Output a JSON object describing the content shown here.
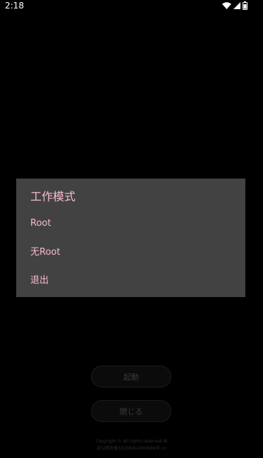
{
  "status_bar": {
    "time": "2:18",
    "icons": [
      "wifi-icon",
      "cell-signal-icon",
      "battery-icon"
    ]
  },
  "background": {
    "start_label": "起動",
    "close_label": "閉じる",
    "footer_copyright": "Copyright © All rights reserved 玩",
    "footer_icp": "浙公网安备33108202000689号 cn"
  },
  "dialog": {
    "title": "工作模式",
    "items": [
      {
        "label": "Root"
      },
      {
        "label": "无Root"
      },
      {
        "label": "退出"
      }
    ]
  },
  "colors": {
    "dialog_background": "#424242",
    "accent_text": "#f8bbd0",
    "screen_background": "#000000"
  }
}
